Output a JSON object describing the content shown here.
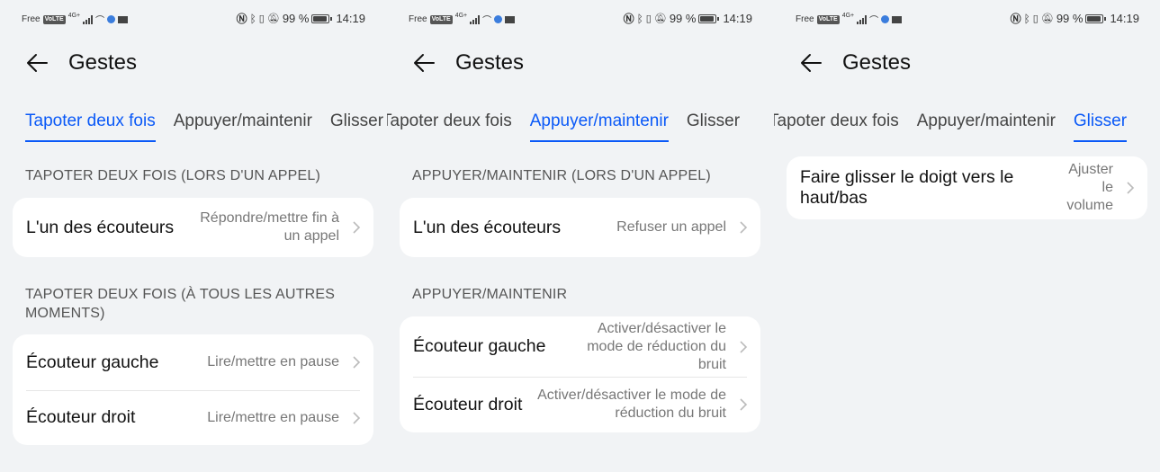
{
  "status_bar": {
    "carrier": "Free",
    "volte": "VoLTE",
    "network": "4G+",
    "battery": "99 %",
    "battery_level": 0.99,
    "time": "14:19"
  },
  "panels": [
    {
      "title": "Gestes",
      "tabs": [
        "Tapoter deux fois",
        "Appuyer/maintenir",
        "Glisser"
      ],
      "active_tab": 0,
      "sections": [
        {
          "heading": "TAPOTER DEUX FOIS (LORS D'UN APPEL)",
          "rows": [
            {
              "label": "L'un des écouteurs",
              "value": "Répondre/mettre fin à un appel"
            }
          ]
        },
        {
          "heading": "TAPOTER DEUX FOIS (À TOUS LES AUTRES MOMENTS)",
          "rows": [
            {
              "label": "Écouteur gauche",
              "value": "Lire/mettre en pause"
            },
            {
              "label": "Écouteur droit",
              "value": "Lire/mettre en pause"
            }
          ]
        }
      ]
    },
    {
      "title": "Gestes",
      "tabs": [
        "Tapoter deux fois",
        "Appuyer/maintenir",
        "Glisser"
      ],
      "active_tab": 1,
      "sections": [
        {
          "heading": "APPUYER/MAINTENIR (LORS D'UN APPEL)",
          "rows": [
            {
              "label": "L'un des écouteurs",
              "value": "Refuser un appel"
            }
          ]
        },
        {
          "heading": "APPUYER/MAINTENIR",
          "rows": [
            {
              "label": "Écouteur gauche",
              "value": "Activer/désactiver le mode de réduction du bruit"
            },
            {
              "label": "Écouteur droit",
              "value": "Activer/désactiver le mode de réduction du bruit"
            }
          ]
        }
      ]
    },
    {
      "title": "Gestes",
      "tabs": [
        "Tapoter deux fois",
        "Appuyer/maintenir",
        "Glisser"
      ],
      "active_tab": 2,
      "sections": [
        {
          "heading": "",
          "rows": [
            {
              "label": "Faire glisser le doigt vers le haut/bas",
              "value": "Ajuster le volume"
            }
          ]
        }
      ]
    }
  ],
  "icons": {
    "back": "back-arrow-icon",
    "chevron": "chevron-right-icon",
    "status": [
      "signal-icon",
      "wifi-icon",
      "vpn-icon",
      "mail-icon",
      "nfc-icon",
      "bluetooth-icon",
      "vibrate-icon",
      "mute-icon",
      "battery-icon"
    ]
  },
  "colors": {
    "accent": "#0a59f7",
    "background": "#f1f3f5",
    "card": "#ffffff",
    "secondary_text": "#777777"
  }
}
